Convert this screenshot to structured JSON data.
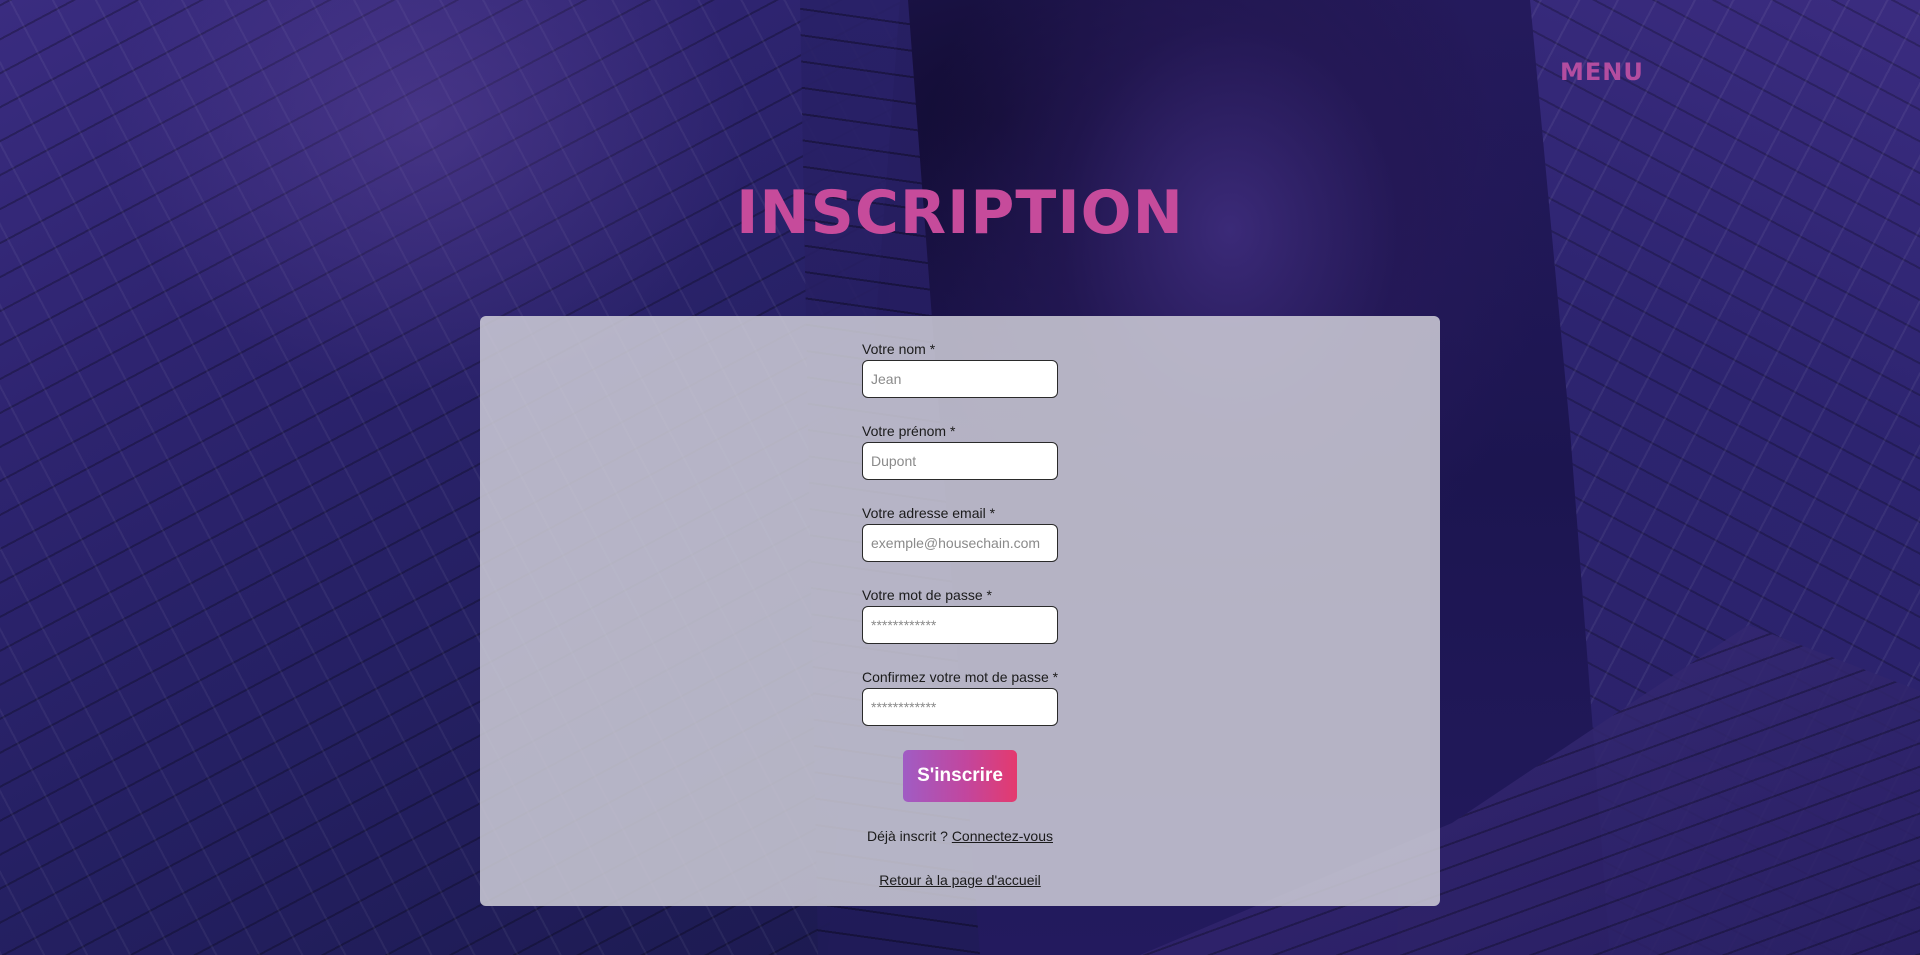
{
  "header": {
    "menu_label": "MENU"
  },
  "page": {
    "title": "INSCRIPTION"
  },
  "form": {
    "fields": [
      {
        "label": "Votre nom *",
        "placeholder": "Jean",
        "value": ""
      },
      {
        "label": "Votre prénom *",
        "placeholder": "Dupont",
        "value": ""
      },
      {
        "label": "Votre adresse email *",
        "placeholder": "exemple@housechain.com",
        "value": ""
      },
      {
        "label": "Votre mot de passe *",
        "placeholder": "************",
        "value": ""
      },
      {
        "label": "Confirmez votre mot de passe *",
        "placeholder": "************",
        "value": ""
      }
    ],
    "submit_label": "S'inscrire"
  },
  "footer": {
    "already_registered_text": "Déjà inscrit ? ",
    "login_link_label": "Connectez-vous",
    "home_link_label": "Retour à la page d'accueil"
  },
  "colors": {
    "accent": "#c64b9b",
    "menu": "#b34da0",
    "button_gradient_start": "#a05cc4",
    "button_gradient_end": "#e43a6e",
    "card_background": "#cecdd7"
  }
}
